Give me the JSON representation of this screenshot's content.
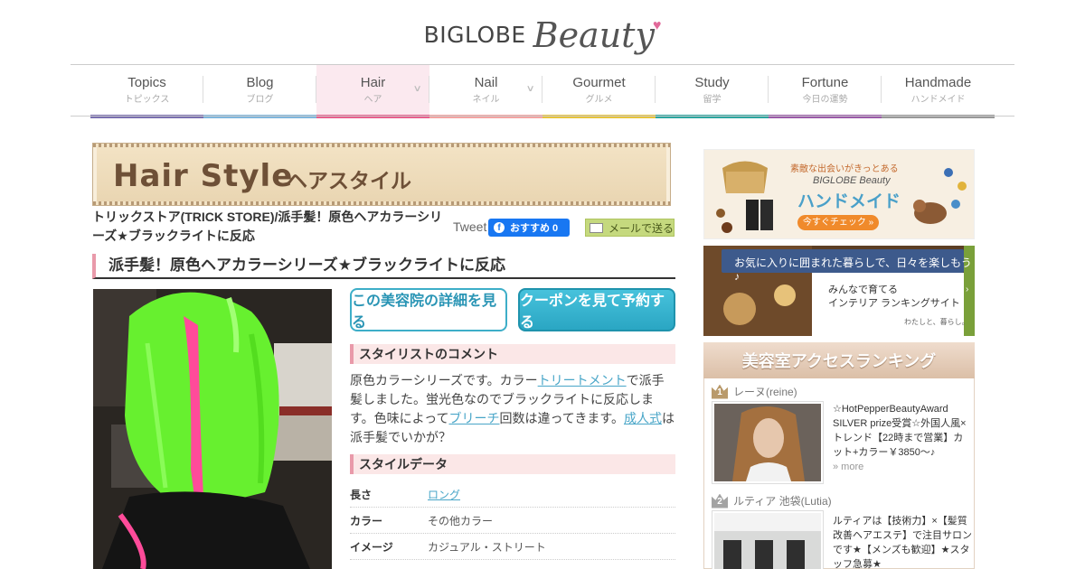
{
  "header": {
    "logo_left": "BIGLOBE",
    "logo_right": "Beauty"
  },
  "nav": [
    {
      "en": "Topics",
      "jp": "トピックス",
      "color": "#7a6fb0",
      "dropdown": false,
      "active": false
    },
    {
      "en": "Blog",
      "jp": "ブログ",
      "color": "#7fb6dd",
      "dropdown": false,
      "active": false
    },
    {
      "en": "Hair",
      "jp": "ヘア",
      "color": "#e85f8c",
      "dropdown": true,
      "active": true
    },
    {
      "en": "Nail",
      "jp": "ネイル",
      "color": "#f3a3a2",
      "dropdown": true,
      "active": false
    },
    {
      "en": "Gourmet",
      "jp": "グルメ",
      "color": "#e7c33b",
      "dropdown": false,
      "active": false
    },
    {
      "en": "Study",
      "jp": "留学",
      "color": "#2ca6a0",
      "dropdown": false,
      "active": false
    },
    {
      "en": "Fortune",
      "jp": "今日の運勢",
      "color": "#9b5aa9",
      "dropdown": false,
      "active": false
    },
    {
      "en": "Handmade",
      "jp": "ハンドメイド",
      "color": "#999999",
      "dropdown": false,
      "active": false
    }
  ],
  "banner": {
    "en": "Hair Style",
    "jp": "ヘアスタイル"
  },
  "article": {
    "shop_title": "トリックストア(TRICK STORE)/派手髪！原色ヘアカラーシリーズ★ブラックライトに反応",
    "tweet": "Tweet",
    "fb_label": "おすすめ 0",
    "mail_label": "メールで送る",
    "heading": "派手髪！原色ヘアカラーシリーズ★ブラックライトに反応",
    "btn_detail": "この美容院の詳細を見る",
    "btn_coupon": "クーポンを見て予約する",
    "comment_heading": "スタイリストのコメント",
    "comment_parts": [
      "原色カラーシリーズです。カラー",
      "トリートメント",
      "で派手髪しました。蛍光色なのでブラックライトに反応します。色味によって",
      "ブリーチ",
      "回数は違ってきます。",
      "成人式",
      "は派手髪でいかが？"
    ],
    "data_heading": "スタイルデータ",
    "data_rows": [
      {
        "k": "長さ",
        "v": "ロング",
        "link": true
      },
      {
        "k": "カラー",
        "v": "その他カラー",
        "link": false
      },
      {
        "k": "イメージ",
        "v": "カジュアル・ストリート",
        "link": false
      }
    ]
  },
  "sidebar": {
    "ad1": {
      "tagline": "素敵な出会いがきっとある",
      "brand": "BIGLOBE Beauty",
      "title": "ハンドメイド",
      "cta": "今すぐチェック »"
    },
    "ad2": {
      "tagline": "お気に入りに囲まれた暮らしで、日々を楽しもう♪",
      "line1": "みんなで育てる",
      "line2": "インテリア ランキングサイト",
      "logo": "わたしと、暮らし。"
    },
    "ranking_title": "美容室アクセスランキング",
    "ranking": [
      {
        "rank": "1",
        "name": "レーヌ(reine)",
        "text": "☆HotPepperBeautyAward SILVER prize受賞☆外国人風×トレンド【22時まで営業】カット+カラー￥3850～♪",
        "more": "» more"
      },
      {
        "rank": "2",
        "name": "ルティア 池袋(Lutia)",
        "text": "ルティアは【技術力】×【髪質改善ヘアエステ】で注目サロンです★【メンズも歓迎】★スタッフ急募★",
        "more": ""
      }
    ]
  }
}
